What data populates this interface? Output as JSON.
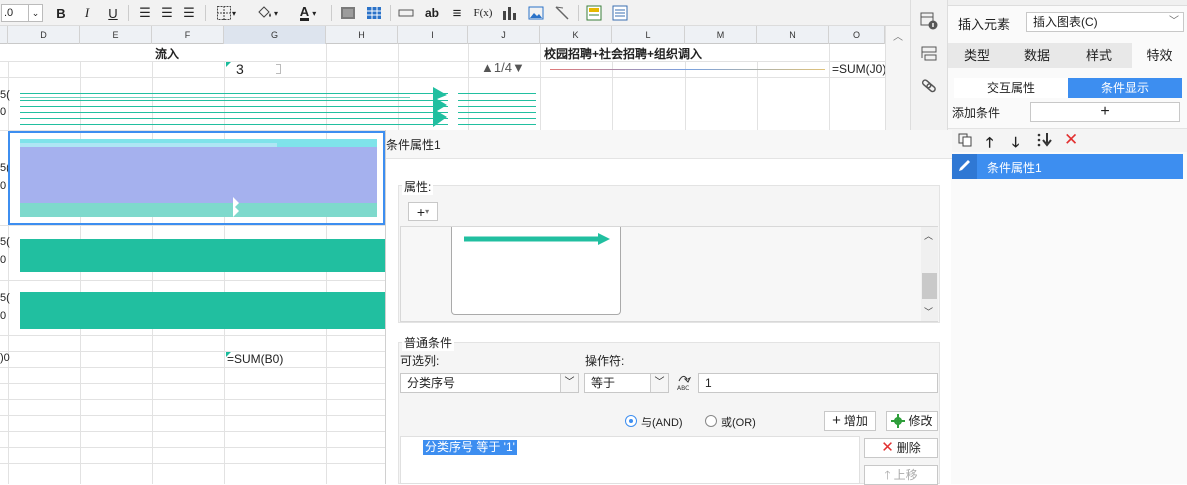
{
  "toolbar": {
    "font_size_value": ".0",
    "bold": "B",
    "italic": "I",
    "underline": "U",
    "text_tool": "ab",
    "formula_tool": "F(x)"
  },
  "columns": [
    "D",
    "E",
    "F",
    "G",
    "H",
    "I",
    "J",
    "K",
    "L",
    "M",
    "N",
    "O"
  ],
  "sheet": {
    "inflow_label": "流入",
    "recruit_label": "校园招聘+社会招聘+组织调入",
    "cell_g_value": "3",
    "page_indicator": "▲1/4▼",
    "sum_j0": "=SUM(J0)",
    "sum_b0": "=SUM(B0)",
    "row_marks": [
      "5(",
      "0",
      "5(",
      "0",
      "5(",
      "0",
      "5(",
      "0",
      ")0"
    ]
  },
  "right_panel": {
    "insert_element_label": "插入元素",
    "insert_chart_value": "插入图表(C)",
    "tabs": [
      "类型",
      "数据",
      "样式",
      "特效"
    ],
    "active_tab": "特效",
    "sub_tabs": [
      "交互属性",
      "条件显示"
    ],
    "active_sub_tab": "条件显示",
    "add_condition_label": "添加条件",
    "add_condition_button": "+",
    "condition_item": "条件属性1"
  },
  "dialog": {
    "title": "条件属性1",
    "properties_label": "属性:",
    "add_property_button": "+",
    "common_conditions_label": "普通条件",
    "optional_column_label": "可选列:",
    "operator_label": "操作符:",
    "optional_column_value": "分类序号",
    "operator_value": "等于",
    "condition_value": "1",
    "and_label": "与(AND)",
    "or_label": "或(OR)",
    "add_button": "增加",
    "modify_button": "修改",
    "condition_expression": "分类序号 等于 '1'",
    "delete_button": "删除",
    "move_up_button": "上移"
  },
  "colors": {
    "accent_blue": "#3d8ef0",
    "chart_teal": "#21bfa0",
    "chart_purple": "#a5b1ee",
    "chart_light_teal": "#7ed9cc",
    "delete_red": "#e23030"
  }
}
